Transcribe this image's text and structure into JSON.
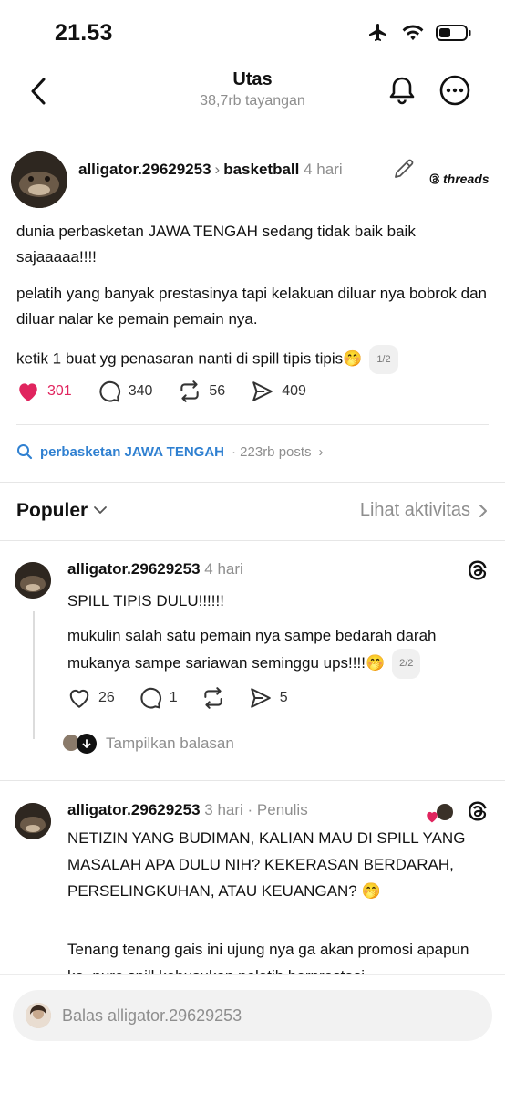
{
  "status": {
    "time": "21.53"
  },
  "nav": {
    "title": "Utas",
    "views": "38,7rb tayangan"
  },
  "post": {
    "username": "alligator.29629253",
    "topic": "basketball",
    "time": "4 hari",
    "brand": "threads",
    "paragraphs": [
      "dunia perbasketan JAWA TENGAH sedang tidak baik baik sajaaaaa!!!!",
      "pelatih yang banyak prestasinya tapi kelakuan diluar nya bobrok dan diluar nalar ke pemain pemain nya.",
      "ketik 1 buat yg penasaran nanti di spill tipis tipis🤭"
    ],
    "pager": "1/2",
    "likes": "301",
    "comments": "340",
    "reposts": "56",
    "shares": "409"
  },
  "tag": {
    "name": "perbasketan JAWA TENGAH",
    "count": "· 223rb posts"
  },
  "section": {
    "sort_label": "Populer",
    "activity_label": "Lihat aktivitas"
  },
  "replies": [
    {
      "username": "alligator.29629253",
      "time": "4 hari",
      "paragraphs": [
        "SPILL TIPIS DULU!!!!!!",
        "mukulin salah satu pemain nya sampe bedarah darah mukanya sampe sariawan seminggu ups!!!!🤭"
      ],
      "pager": "2/2",
      "likes": "26",
      "comments": "1",
      "shares": "5",
      "show_replies": "Tampilkan balasan"
    },
    {
      "username": "alligator.29629253",
      "time": "3 hari",
      "author_tag": "· Penulis",
      "paragraphs": [
        "NETIZIN YANG BUDIMAN, KALIAN MAU DI SPILL YANG MASALAH APA DULU NIH? KEKERASAN BERDARAH, PERSELINGKUHAN, ATAU KEUANGAN? 🤭",
        "Tenang tenang gais ini ujung nya ga akan promosi apapun ko, pure spill kebusukan pelatih berprestasi"
      ]
    }
  ],
  "composer": {
    "placeholder": "Balas alligator.29629253"
  },
  "colors": {
    "like": "#e0245e",
    "link": "#2f80d1",
    "muted": "#8e8e8e"
  },
  "icons": [
    "back-icon",
    "bell-icon",
    "more-icon",
    "pencil-icon",
    "threads-icon",
    "heart-icon",
    "comment-icon",
    "repost-icon",
    "share-icon",
    "search-icon",
    "chevron-down-icon",
    "chevron-right-icon",
    "airplane-icon",
    "wifi-icon",
    "battery-icon"
  ]
}
